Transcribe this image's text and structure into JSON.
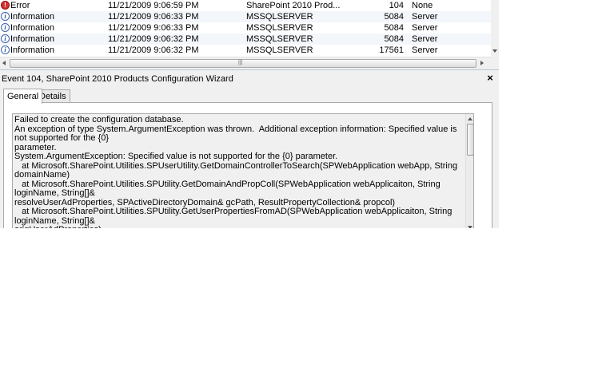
{
  "events": [
    {
      "level": "Error",
      "level_icon": "error-icon",
      "date": "11/21/2009 9:06:59 PM",
      "source": "SharePoint 2010 Prod...",
      "id": "104",
      "category": "None"
    },
    {
      "level": "Information",
      "level_icon": "info-icon",
      "date": "11/21/2009 9:06:33 PM",
      "source": "MSSQLSERVER",
      "id": "5084",
      "category": "Server"
    },
    {
      "level": "Information",
      "level_icon": "info-icon",
      "date": "11/21/2009 9:06:33 PM",
      "source": "MSSQLSERVER",
      "id": "5084",
      "category": "Server"
    },
    {
      "level": "Information",
      "level_icon": "info-icon",
      "date": "11/21/2009 9:06:32 PM",
      "source": "MSSQLSERVER",
      "id": "5084",
      "category": "Server"
    },
    {
      "level": "Information",
      "level_icon": "info-icon",
      "date": "11/21/2009 9:06:32 PM",
      "source": "MSSQLSERVER",
      "id": "17561",
      "category": "Server"
    }
  ],
  "detail": {
    "title": "Event 104, SharePoint 2010 Products Configuration Wizard",
    "close_glyph": "×",
    "tabs": [
      {
        "label": "General",
        "selected": true
      },
      {
        "label": "Details",
        "selected": false
      }
    ],
    "description": "Failed to create the configuration database.\nAn exception of type System.ArgumentException was thrown.  Additional exception information: Specified value is not supported for the {0}\nparameter.\nSystem.ArgumentException: Specified value is not supported for the {0} parameter.\n   at Microsoft.SharePoint.Utilities.SPUserUtility.GetDomainControllerToSearch(SPWebApplication webApp, String domainName)\n   at Microsoft.SharePoint.Utilities.SPUtility.GetDomainAndPropColl(SPWebApplication webApplicaiton, String loginName, String[]&\nresolveUserAdProperties, SPActiveDirectoryDomain& gcPath, ResultPropertyCollection& propcol)\n   at Microsoft.SharePoint.Utilities.SPUtility.GetUserPropertiesFromAD(SPWebApplication webApplicaiton, String loginName, String[]&\norigUserAdProperties)\n   at Microsoft.SharePoint.Utilities.SPUtility.GetUserPropertyFromAD(SPWebApplication webApplicaiton, String loginName, String\npropertyName)\n   at Microsoft.SharePoint.Administration.SPManagedAccount.GetUserAccountControl(String username)\n   at Microsoft.SharePoint.Administration.SPManagedAccount.Update()"
  },
  "colors": {
    "row_alt": "#f3f6fa",
    "window_bg": "#f0f0f0",
    "error": "#d23131",
    "info": "#3a64b0"
  }
}
